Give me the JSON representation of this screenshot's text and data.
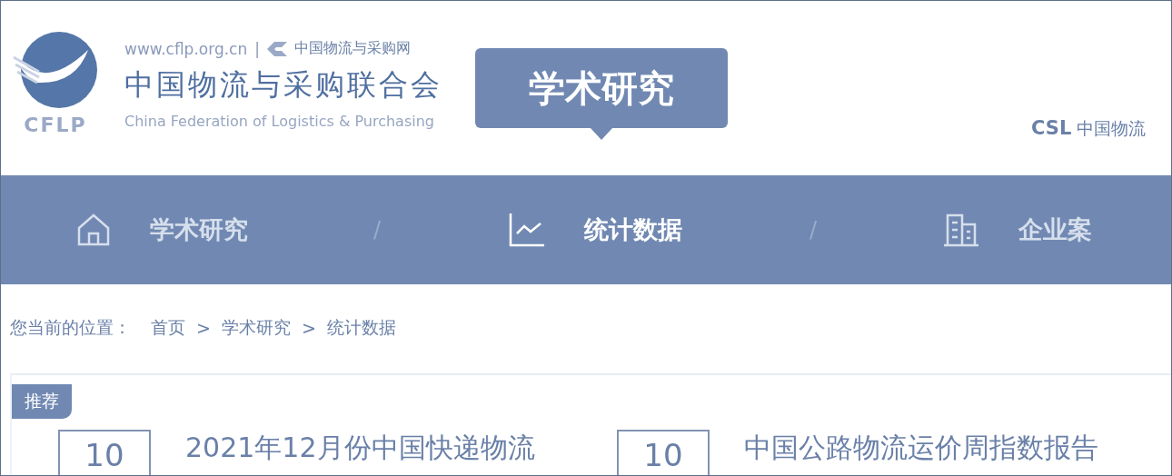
{
  "header": {
    "logo_text": "CFLP",
    "url": "www.cflp.org.cn",
    "divider": "|",
    "site_name": "中国物流与采购网",
    "org_name": "中国物流与采购联合会",
    "org_name_en": "China Federation of Logistics & Purchasing",
    "banner": "学术研究",
    "right_text_bold": "CSL",
    "right_text": "中国物流"
  },
  "nav": {
    "separator": "/",
    "items": [
      {
        "label": "学术研究",
        "selected": false
      },
      {
        "label": "统计数据",
        "selected": true
      },
      {
        "label": "企业案",
        "selected": false
      }
    ]
  },
  "breadcrumb": {
    "label": "您当前的位置：",
    "separator": ">",
    "items": [
      "首页",
      "学术研究",
      "统计数据"
    ]
  },
  "section": {
    "tag": "推荐",
    "articles": [
      {
        "day": "10",
        "title": "2021年12月份中国快递物流"
      },
      {
        "day": "10",
        "title": "中国公路物流运价周指数报告"
      }
    ]
  }
}
